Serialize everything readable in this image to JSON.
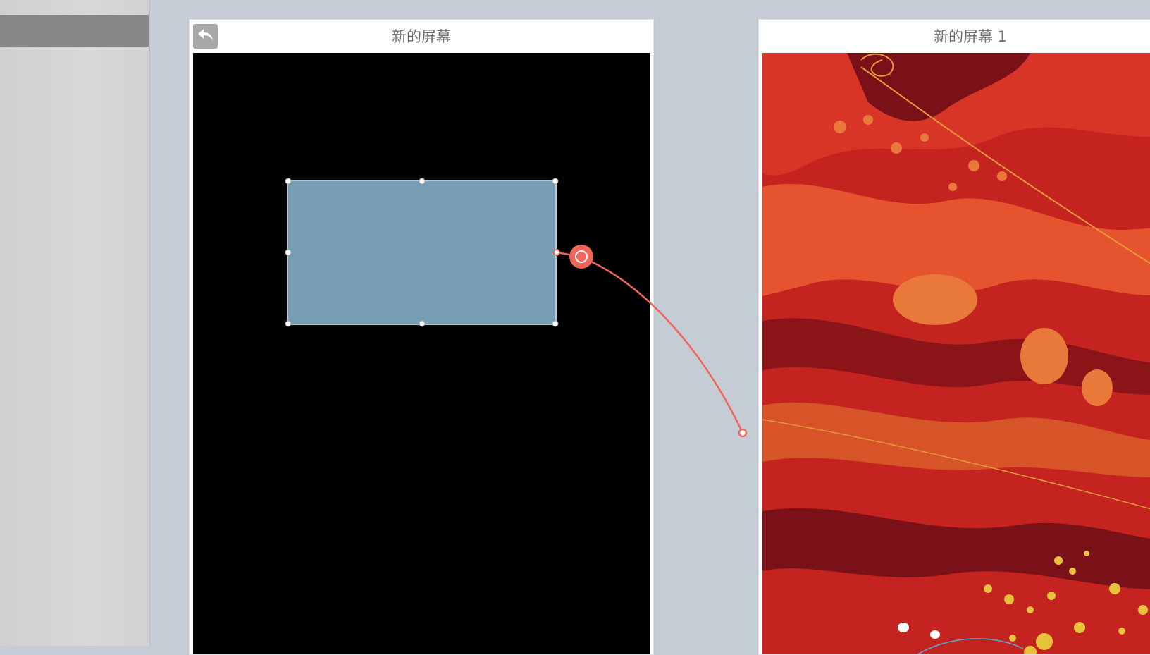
{
  "screens": [
    {
      "title": "新的屏幕",
      "background": "#000000"
    },
    {
      "title": "新的屏幕 1",
      "background": "#b8201f"
    }
  ],
  "toolbar": {
    "back_icon": "back-arrow-icon"
  },
  "hotspot": {
    "fill": "#789eb4"
  },
  "link": {
    "color": "#f0645a"
  }
}
